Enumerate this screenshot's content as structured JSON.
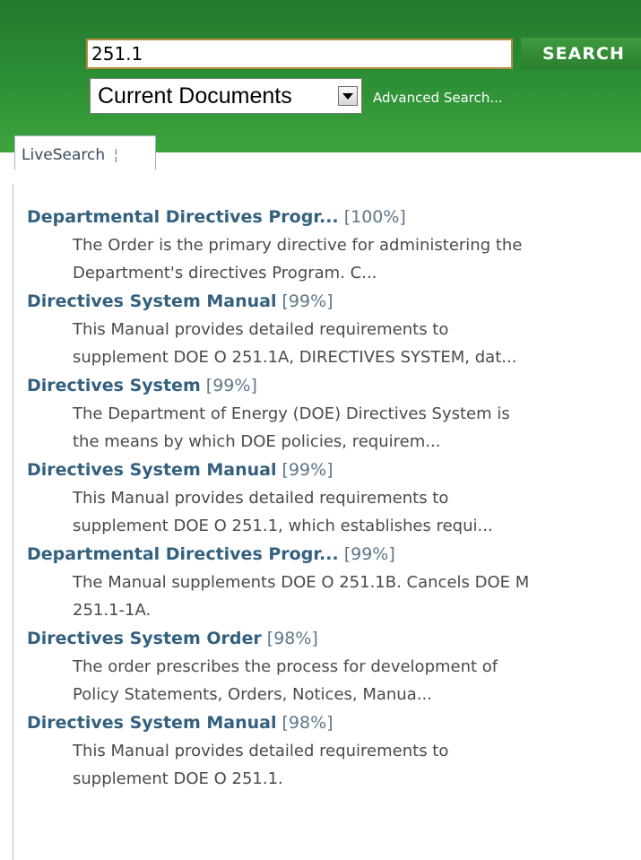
{
  "search": {
    "query": "251.1",
    "button_label": "SEARCH",
    "scope_selected": "Current Documents",
    "advanced_link": "Advanced Search..."
  },
  "tabs": {
    "livesearch_label": "LiveSearch",
    "separator": "¦"
  },
  "colors": {
    "header_green": "#2a8c34",
    "result_title": "#33607e",
    "result_score": "#5f7688",
    "result_desc": "#4a4a4a"
  },
  "results": [
    {
      "title": "Departmental Directives Progr...",
      "score": "[100%]",
      "desc_line1": "The Order is the primary directive for administering the",
      "desc_line2": "Department's directives Program. C..."
    },
    {
      "title": "Directives System Manual",
      "score": "[99%]",
      "desc_line1": "This Manual provides detailed requirements to",
      "desc_line2": "supplement DOE O 251.1A, DIRECTIVES SYSTEM, dat..."
    },
    {
      "title": "Directives System",
      "score": "[99%]",
      "desc_line1": "The Department of Energy (DOE) Directives System is",
      "desc_line2": "the means by which DOE policies, requirem..."
    },
    {
      "title": "Directives System Manual",
      "score": "[99%]",
      "desc_line1": "This Manual provides detailed requirements to",
      "desc_line2": "supplement DOE O 251.1, which establishes requi..."
    },
    {
      "title": "Departmental Directives Progr...",
      "score": "[99%]",
      "desc_line1": "The Manual supplements DOE O 251.1B. Cancels DOE M",
      "desc_line2": "251.1-1A."
    },
    {
      "title": "Directives System Order",
      "score": "[98%]",
      "desc_line1": "The order prescribes the process for development of",
      "desc_line2": "Policy Statements, Orders, Notices, Manua..."
    },
    {
      "title": "Directives System Manual",
      "score": "[98%]",
      "desc_line1": "This Manual provides detailed requirements to",
      "desc_line2": "supplement DOE O 251.1."
    }
  ]
}
